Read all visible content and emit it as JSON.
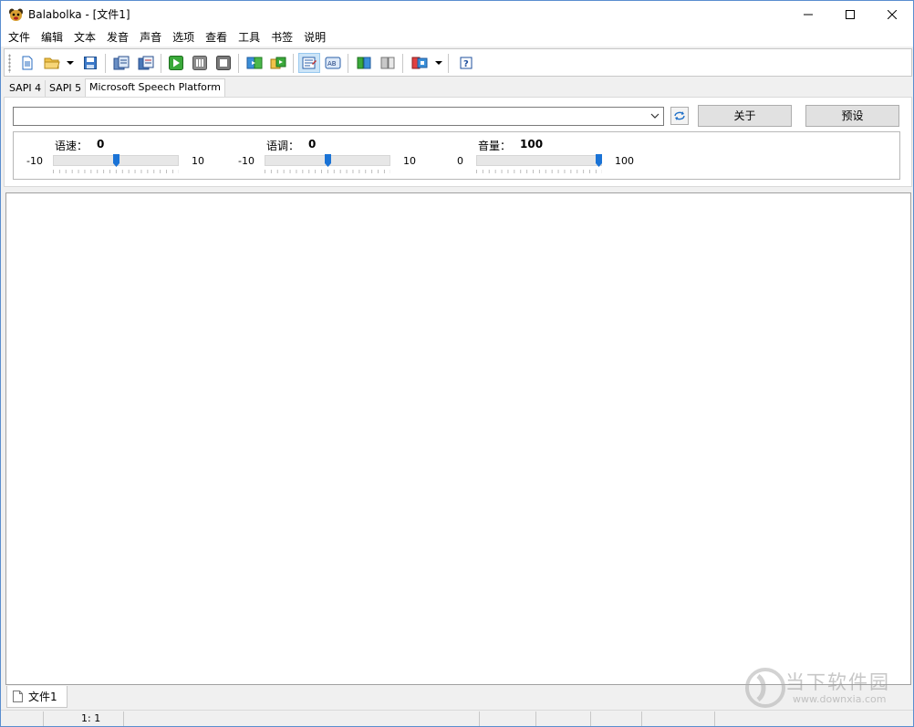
{
  "window": {
    "title": "Balabolka - [文件1]"
  },
  "menu": [
    "文件",
    "编辑",
    "文本",
    "发音",
    "声音",
    "选项",
    "查看",
    "工具",
    "书签",
    "说明"
  ],
  "toolbar": {
    "icons": [
      "new-file-icon",
      "open-folder-icon",
      "save-icon",
      "read-clipboard-icon",
      "read-selection-icon",
      "play-icon",
      "pause-icon",
      "stop-icon",
      "convert-audio-icon",
      "batch-convert-icon",
      "text-view-icon",
      "spell-icon",
      "export-left-icon",
      "export-right-icon",
      "voice-option-icon",
      "help-icon"
    ]
  },
  "tabs": [
    "SAPI 4",
    "SAPI 5",
    "Microsoft Speech Platform"
  ],
  "voice": {
    "selected": "",
    "about_label": "关于",
    "preset_label": "预设"
  },
  "params": [
    {
      "label": "语速：",
      "value": "0",
      "min": "-10",
      "max": "10",
      "level": 0.5
    },
    {
      "label": "语调：",
      "value": "0",
      "min": "-10",
      "max": "10",
      "level": 0.5
    },
    {
      "label": "音量：",
      "value": "100",
      "min": "0",
      "max": "100",
      "level": 1.0
    }
  ],
  "editor": {
    "text": ""
  },
  "doc_tab": {
    "label": "文件1"
  },
  "status": {
    "position": "1:   1"
  },
  "watermark": {
    "main": "当下软件园",
    "url": "www.downxia.com"
  }
}
